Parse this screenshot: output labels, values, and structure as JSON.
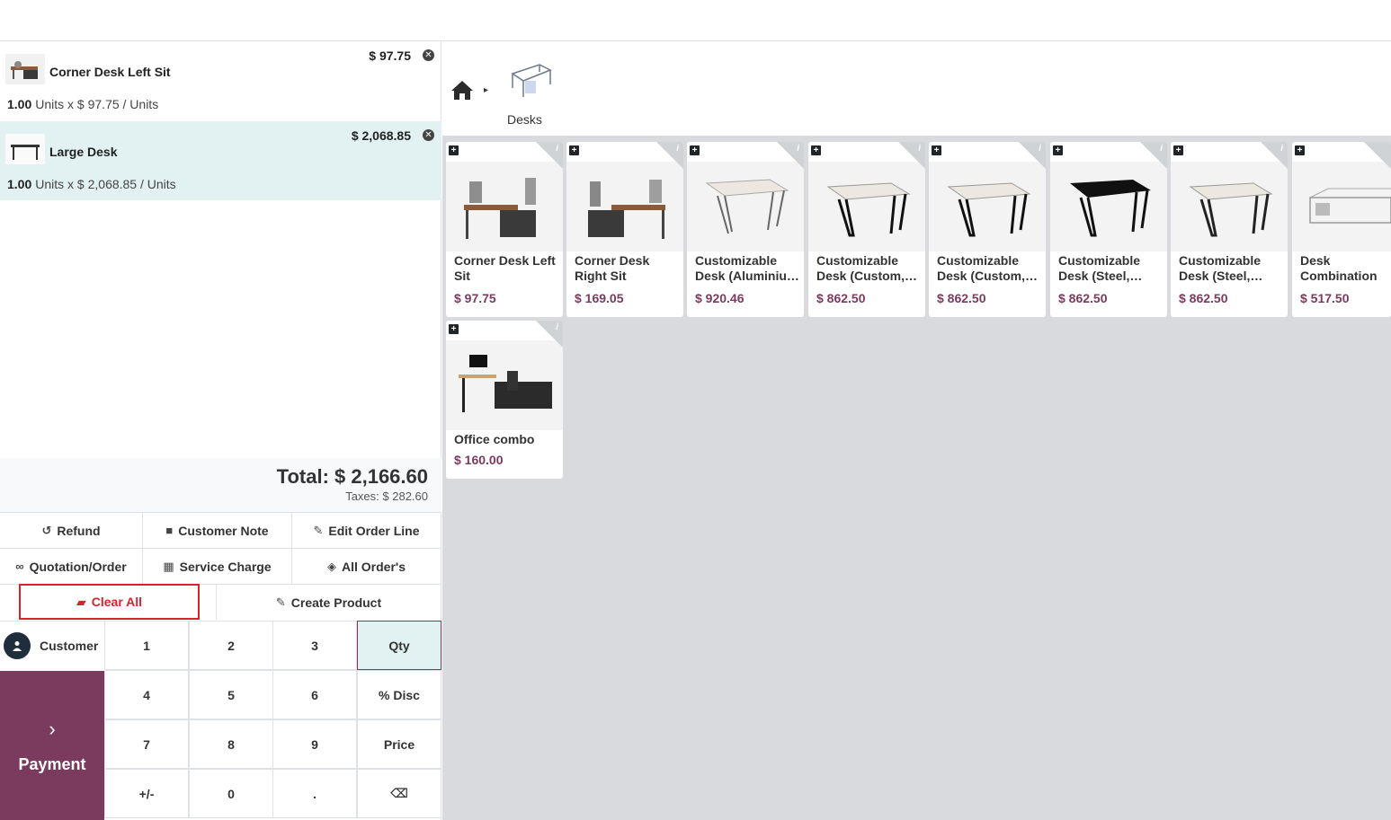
{
  "order": {
    "lines": [
      {
        "name": "Corner Desk Left Sit",
        "price": "$ 97.75",
        "qty": "1.00",
        "unit_text": "Units x $ 97.75 / Units",
        "selected": false
      },
      {
        "name": "Large Desk",
        "price": "$ 2,068.85",
        "qty": "1.00",
        "unit_text": "Units x $ 2,068.85 / Units",
        "selected": true
      }
    ],
    "total": "Total: $ 2,166.60",
    "taxes": "Taxes: $ 282.60"
  },
  "controls": {
    "refund": "Refund",
    "customer_note": "Customer Note",
    "edit_order_line": "Edit Order Line",
    "quotation_order": "Quotation/Order",
    "service_charge": "Service Charge",
    "all_orders": "All Order's",
    "clear_all": "Clear All",
    "create_product": "Create Product"
  },
  "numpad": {
    "customer": "Customer",
    "payment": "Payment",
    "keys": [
      "1",
      "2",
      "3",
      "Qty",
      "4",
      "5",
      "6",
      "% Disc",
      "7",
      "8",
      "9",
      "Price",
      "+/-",
      "0",
      ".",
      "⌫"
    ]
  },
  "breadcrumb": {
    "category": "Desks"
  },
  "products": [
    {
      "name": "Corner Desk Left Sit",
      "price": "$ 97.75",
      "icon": "corner-desk-left"
    },
    {
      "name": "Corner Desk Right Sit",
      "price": "$ 169.05",
      "icon": "corner-desk-right"
    },
    {
      "name": "Customizable Desk (Aluminiu…",
      "price": "$ 920.46",
      "icon": "white-desk-grey-legs"
    },
    {
      "name": "Customizable Desk (Custom,…",
      "price": "$ 862.50",
      "icon": "white-desk-black-legs"
    },
    {
      "name": "Customizable Desk (Custom,…",
      "price": "$ 862.50",
      "icon": "white-desk-black-legs"
    },
    {
      "name": "Customizable Desk (Steel,…",
      "price": "$ 862.50",
      "icon": "black-desk"
    },
    {
      "name": "Customizable Desk (Steel,…",
      "price": "$ 862.50",
      "icon": "white-desk-black-legs"
    },
    {
      "name": "Desk Combination",
      "price": "$ 517.50",
      "icon": "desk-combination"
    },
    {
      "name": "Office combo",
      "price": "$ 160.00",
      "icon": "office-combo"
    }
  ],
  "colors": {
    "accent": "#7a3b5e",
    "selected_line": "#e2f2f2",
    "clear_all": "#d9232d"
  }
}
